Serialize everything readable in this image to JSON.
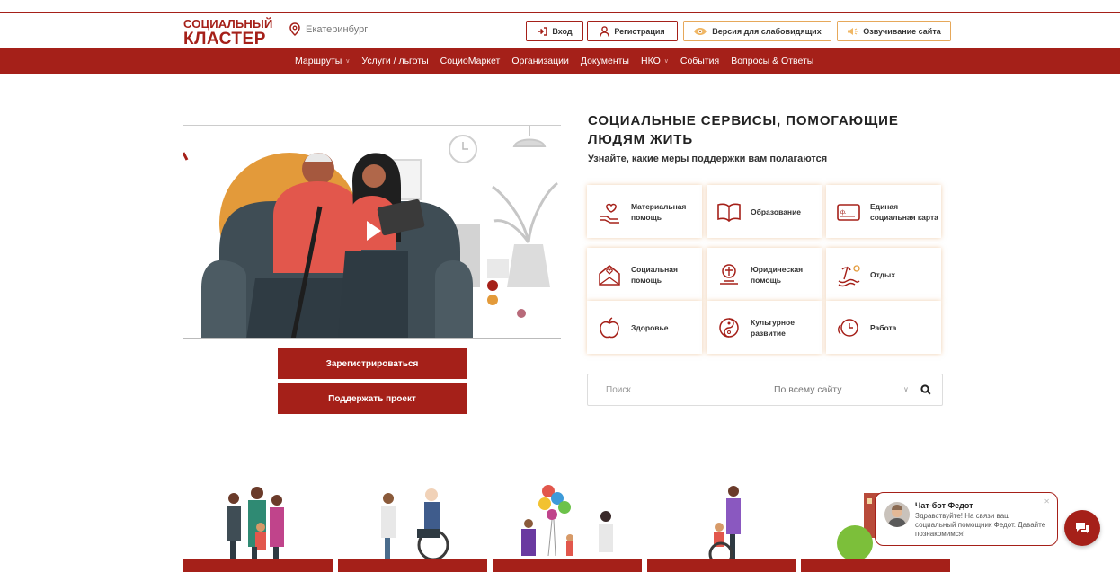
{
  "header": {
    "logo_line1": "СОЦИАЛЬНЫЙ",
    "logo_line2": "КЛАСТЕР",
    "city": "Екатеринбург",
    "login_label": "Вход",
    "register_label": "Регистрация",
    "accessibility_label": "Версия для слабовидящих",
    "voice_label": "Озвучивание сайта"
  },
  "nav": {
    "items": [
      {
        "label": "Маршруты",
        "has_dropdown": true
      },
      {
        "label": "Услуги / льготы",
        "has_dropdown": false
      },
      {
        "label": "СоциоМаркет",
        "has_dropdown": false
      },
      {
        "label": "Организации",
        "has_dropdown": false
      },
      {
        "label": "Документы",
        "has_dropdown": false
      },
      {
        "label": "НКО",
        "has_dropdown": true
      },
      {
        "label": "События",
        "has_dropdown": false
      },
      {
        "label": "Вопросы & Ответы",
        "has_dropdown": false
      }
    ]
  },
  "hero": {
    "title": "СОЦИАЛЬНЫЕ СЕРВИСЫ, ПОМОГАЮЩИЕ ЛЮДЯМ ЖИТЬ",
    "subtitle": "Узнайте, какие меры поддержки вам полагаются",
    "register_button": "Зарегистрироваться",
    "support_button": "Поддержать проект"
  },
  "services": [
    {
      "label": "Материальная помощь",
      "icon": "hand-heart-icon"
    },
    {
      "label": "Образование",
      "icon": "book-icon"
    },
    {
      "label": "Единая социальная карта",
      "icon": "card-icon"
    },
    {
      "label": "Социальная помощь",
      "icon": "envelope-heart-icon"
    },
    {
      "label": "Юридическая помощь",
      "icon": "scales-icon"
    },
    {
      "label": "Отдых",
      "icon": "beach-icon"
    },
    {
      "label": "Здоровье",
      "icon": "apple-icon"
    },
    {
      "label": "Культурное развитие",
      "icon": "yin-yang-icon"
    },
    {
      "label": "Работа",
      "icon": "clock-icon"
    }
  ],
  "search": {
    "placeholder": "Поиск",
    "scope": "По всему сайту"
  },
  "chat": {
    "title": "Чат-бот Федот",
    "message": "Здравствуйте! На связи ваш социальный помощник Федот. Давайте познакомимся!"
  },
  "colors": {
    "brand": "#a52019",
    "accent_orange": "#e6a85a",
    "video_sofa": "#3f4d55",
    "video_sweater": "#e2574c"
  }
}
